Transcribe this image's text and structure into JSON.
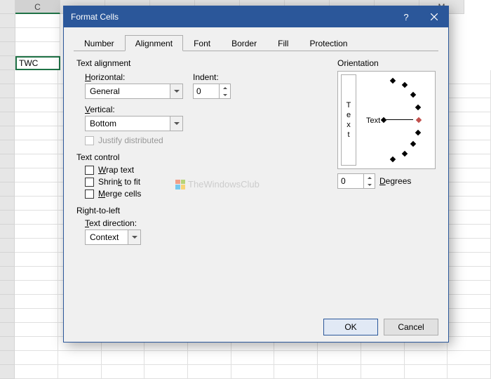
{
  "sheet": {
    "visible_cols": [
      "C",
      "",
      "",
      "",
      "",
      "",
      "",
      "",
      "",
      "M"
    ],
    "active_cell_value": "TWC"
  },
  "dialog": {
    "title": "Format Cells",
    "tabs": [
      "Number",
      "Alignment",
      "Font",
      "Border",
      "Fill",
      "Protection"
    ],
    "active_tab": "Alignment",
    "text_alignment": {
      "label": "Text alignment",
      "horizontal_label": "Horizontal:",
      "horizontal_value": "General",
      "indent_label": "Indent:",
      "indent_value": "0",
      "vertical_label": "Vertical:",
      "vertical_value": "Bottom",
      "justify_label": "Justify distributed"
    },
    "text_control": {
      "label": "Text control",
      "wrap": "Wrap text",
      "shrink": "Shrink to fit",
      "merge": "Merge cells"
    },
    "rtl": {
      "label": "Right-to-left",
      "direction_label": "Text direction:",
      "direction_value": "Context"
    },
    "orientation": {
      "label": "Orientation",
      "v_text": "Text",
      "h_text": "Text",
      "degrees_value": "0",
      "degrees_label": "Degrees"
    },
    "buttons": {
      "ok": "OK",
      "cancel": "Cancel"
    }
  },
  "watermark": "TheWindowsClub"
}
